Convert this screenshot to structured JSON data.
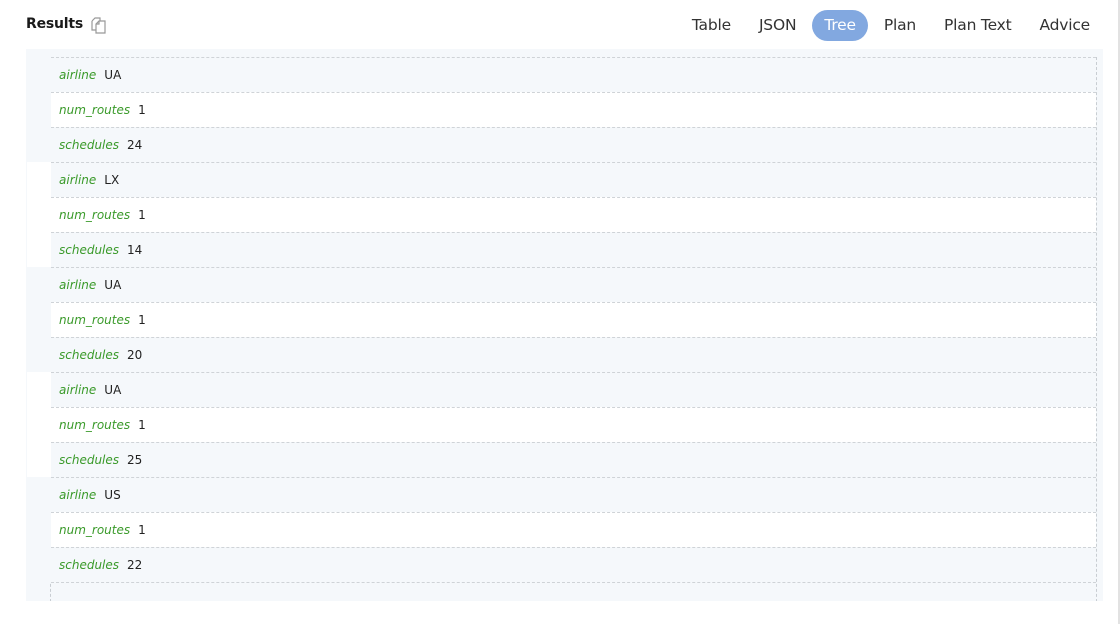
{
  "header": {
    "title": "Results",
    "copy_icon": "copy-icon"
  },
  "tabs": [
    {
      "label": "Table",
      "active": false
    },
    {
      "label": "JSON",
      "active": false
    },
    {
      "label": "Tree",
      "active": true
    },
    {
      "label": "Plan",
      "active": false
    },
    {
      "label": "Plan Text",
      "active": false
    },
    {
      "label": "Advice",
      "active": false
    }
  ],
  "colors": {
    "active_tab": "#82a8e0",
    "key_text": "#3a9a2a",
    "panel_bg": "#f5f8fb"
  },
  "results": [
    {
      "airline": "UA",
      "num_routes": "1",
      "schedules": "24"
    },
    {
      "airline": "LX",
      "num_routes": "1",
      "schedules": "14"
    },
    {
      "airline": "UA",
      "num_routes": "1",
      "schedules": "20"
    },
    {
      "airline": "UA",
      "num_routes": "1",
      "schedules": "25"
    },
    {
      "airline": "US",
      "num_routes": "1",
      "schedules": "22"
    }
  ],
  "keys": [
    "airline",
    "num_routes",
    "schedules"
  ]
}
